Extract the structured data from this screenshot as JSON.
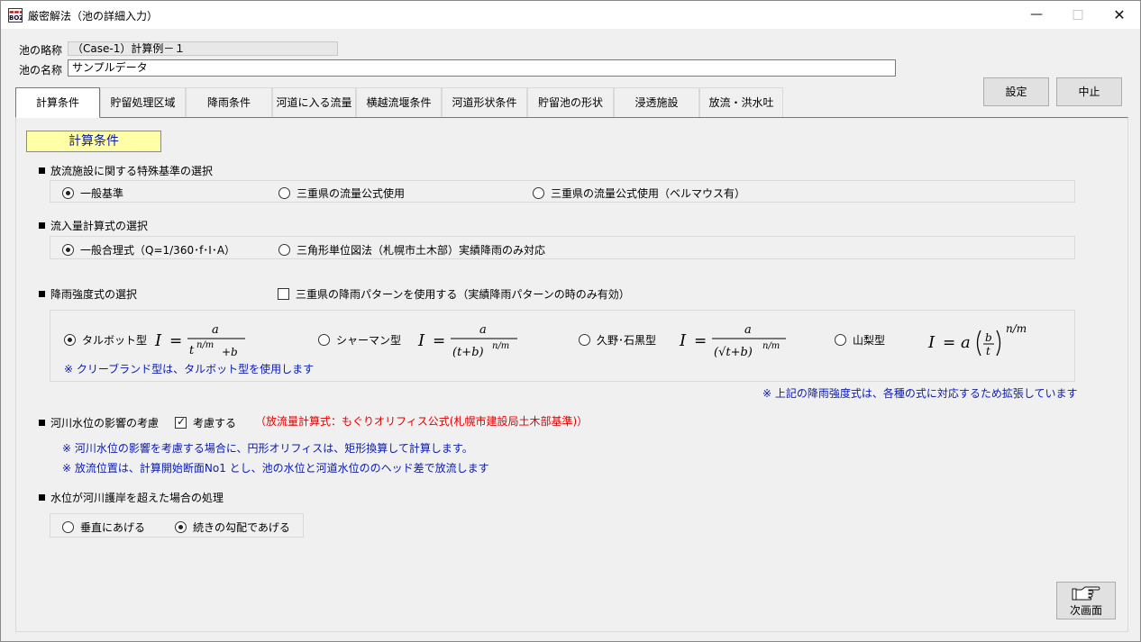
{
  "window": {
    "title": "厳密解法（池の詳細入力）",
    "icon_text_top": "▬▬▬",
    "icon_text_bottom": "BOZ"
  },
  "header": {
    "short_name_label": "池の略称",
    "short_name_value": "（Case-1）計算例－１",
    "name_label": "池の名称",
    "name_value": "サンプルデータ"
  },
  "buttons": {
    "set": "設定",
    "cancel": "中止",
    "next": "次画面"
  },
  "tabs": [
    "計算条件",
    "貯留処理区域",
    "降雨条件",
    "河道に入る流量",
    "横越流堰条件",
    "河道形状条件",
    "貯留池の形状",
    "浸透施設",
    "放流・洪水吐"
  ],
  "section_title": "計算条件",
  "discharge": {
    "heading": "放流施設に関する特殊基準の選択",
    "options": [
      "一般基準",
      "三重県の流量公式使用",
      "三重県の流量公式使用（ベルマウス有）"
    ],
    "selected": 0
  },
  "inflow": {
    "heading": "流入量計算式の選択",
    "options": [
      "一般合理式（Q=1/360･f･I･A）",
      "三角形単位図法（札幌市土木部）実績降雨のみ対応"
    ],
    "selected": 0
  },
  "rainfall": {
    "heading": "降雨強度式の選択",
    "mie_pattern_label": "三重県の降雨パターンを使用する（実績降雨パターンの時のみ有効）",
    "mie_pattern_checked": false,
    "options": [
      "タルボット型",
      "シャーマン型",
      "久野･石黒型",
      "山梨型"
    ],
    "selected": 0,
    "note_cleveland": "※ クリーブランド型は、タルボット型を使用します",
    "note_extended": "※ 上記の降雨強度式は、各種の式に対応するため拡張しています"
  },
  "formulas": {
    "I": "I",
    "eq": "=",
    "a": "a",
    "b": "b",
    "t": "t",
    "nm": "n/m",
    "plus_b": "+b",
    "open_t": "(t+b)",
    "sqrt_t": "(√t+b)"
  },
  "river": {
    "heading": "河川水位の影響の考慮",
    "checkbox_label": "考慮する",
    "checked": true,
    "formula_note": "（放流量計算式：もぐりオリフィス公式(札幌市建設局土木部基準)）",
    "note1": "※ 河川水位の影響を考慮する場合に、円形オリフィスは、矩形換算して計算します。",
    "note2": "※ 放流位置は、計算開始断面No1 とし、池の水位と河道水位ののヘッド差で放流します"
  },
  "overflow": {
    "heading": "水位が河川護岸を超えた場合の処理",
    "options": [
      "垂直にあげる",
      "続きの勾配であげる"
    ],
    "selected": 1
  }
}
